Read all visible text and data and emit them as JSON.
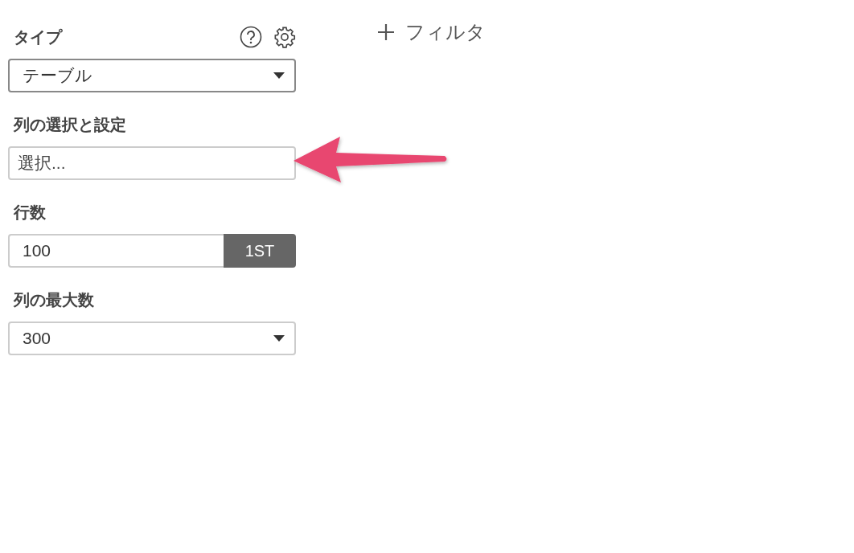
{
  "panel": {
    "fields": [
      {
        "kind": "select",
        "label": "タイプ",
        "value": "テーブル",
        "focused": true
      },
      {
        "kind": "input",
        "label": "列の選択と設定",
        "placeholder": "選択...",
        "focused": false
      },
      {
        "kind": "addon",
        "label": "行数",
        "value": "100",
        "addon": "1ST",
        "focused": false
      },
      {
        "kind": "select",
        "label": "列の最大数",
        "value": "300",
        "focused": false
      }
    ]
  },
  "filter_button": {
    "label": "フィルタ"
  }
}
